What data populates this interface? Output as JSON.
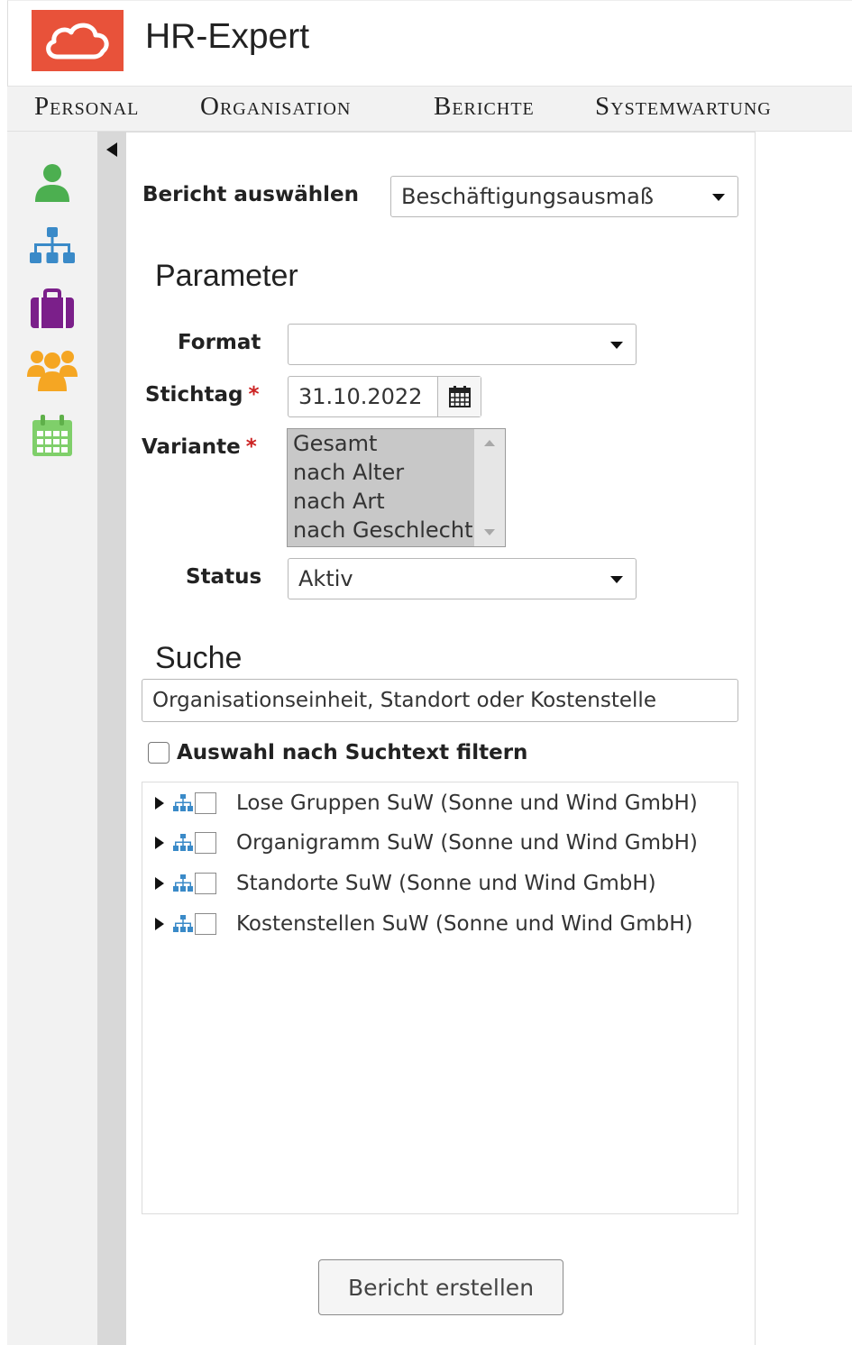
{
  "app": {
    "title": "HR-Expert"
  },
  "nav": [
    "Personal",
    "Organisation",
    "Berichte",
    "Systemwartung"
  ],
  "sidebar_icons": [
    "person-icon",
    "org-chart-icon",
    "briefcase-icon",
    "group-icon",
    "calendar-icon"
  ],
  "report": {
    "label": "Bericht auswählen",
    "selected": "Beschäftigungsausmaß"
  },
  "parameter": {
    "title": "Parameter",
    "format": {
      "label": "Format",
      "value": ""
    },
    "stichtag": {
      "label": "Stichtag",
      "required_mark": "*",
      "value": "31.10.2022"
    },
    "variante": {
      "label": "Variante",
      "required_mark": "*",
      "options": [
        "Gesamt",
        "nach Alter",
        "nach Art",
        "nach Geschlecht"
      ]
    },
    "status": {
      "label": "Status",
      "value": "Aktiv"
    }
  },
  "search": {
    "title": "Suche",
    "placeholder": "Organisationseinheit, Standort oder Kostenstelle",
    "filter_label": "Auswahl nach Suchtext filtern"
  },
  "tree": [
    "Lose Gruppen SuW (Sonne und Wind GmbH)",
    "Organigramm SuW (Sonne und Wind GmbH)",
    "Standorte SuW (Sonne und Wind GmbH)",
    "Kostenstellen SuW (Sonne und Wind GmbH)"
  ],
  "submit_label": "Bericht erstellen",
  "colors": {
    "brand": "#e8523a",
    "person": "#4caf50",
    "org": "#3a8ac8",
    "briefcase": "#7b1f8a",
    "group": "#f5a623",
    "calendar": "#7fcf6a",
    "required": "#cc2222"
  }
}
